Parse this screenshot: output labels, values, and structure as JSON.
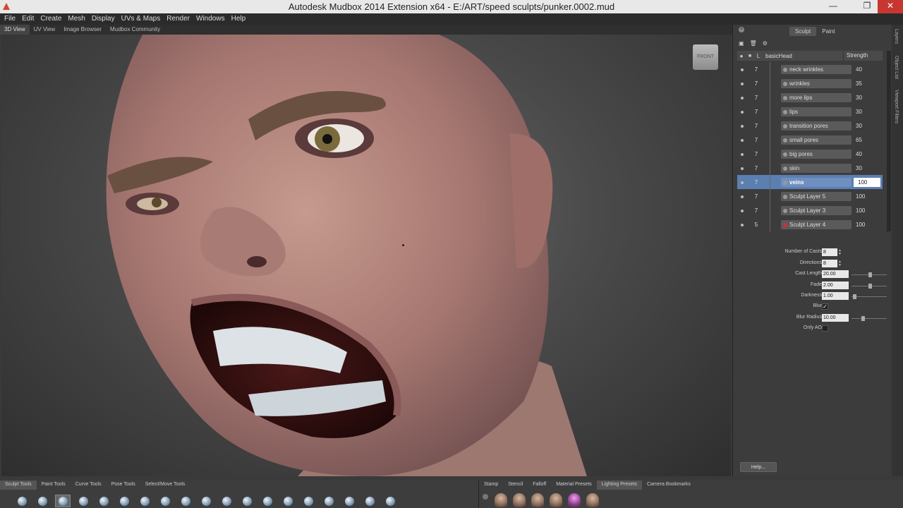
{
  "window": {
    "title": "Autodesk Mudbox 2014 Extension x64 - E:/ART/speed sculpts/punker.0002.mud",
    "close_glyph": "✕",
    "max_glyph": "❐",
    "min_glyph": "—"
  },
  "menu": [
    "File",
    "Edit",
    "Create",
    "Mesh",
    "Display",
    "UVs & Maps",
    "Render",
    "Windows",
    "Help"
  ],
  "view_tabs": [
    "3D View",
    "UV View",
    "Image Browser",
    "Mudbox Community"
  ],
  "viewport": {
    "viewcube_label": "FRONT"
  },
  "right_panel": {
    "mode_tabs": [
      "Sculpt",
      "Paint"
    ],
    "close_glyph": "×",
    "layer_header": {
      "name": "basicHead",
      "strength": "Strength",
      "l": "L"
    },
    "layers": [
      {
        "level": "7",
        "name": "neck wrinkles",
        "strength": "40"
      },
      {
        "level": "7",
        "name": "wrinkles",
        "strength": "35"
      },
      {
        "level": "7",
        "name": "more lips",
        "strength": "30"
      },
      {
        "level": "7",
        "name": "lips",
        "strength": "30"
      },
      {
        "level": "7",
        "name": "transition pores",
        "strength": "30"
      },
      {
        "level": "7",
        "name": "small pores",
        "strength": "65"
      },
      {
        "level": "7",
        "name": "big pores",
        "strength": "40"
      },
      {
        "level": "7",
        "name": "skin",
        "strength": "30"
      },
      {
        "level": "7",
        "name": "veins",
        "strength": "100",
        "selected": true
      },
      {
        "level": "7",
        "name": "Sculpt Layer 5",
        "strength": "100"
      },
      {
        "level": "7",
        "name": "Sculpt Layer 3",
        "strength": "100"
      },
      {
        "level": "5",
        "name": "Sculpt Layer 4",
        "strength": "100",
        "red": true
      }
    ],
    "ao": {
      "num_casts_label": "Number of Casts",
      "num_casts": "8",
      "directions_label": "Directions",
      "directions": "8",
      "cast_length_label": "Cast Length",
      "cast_length": "20.00",
      "fade_label": "Fade",
      "fade": "2.00",
      "darkness_label": "Darkness",
      "darkness": "1.00",
      "blur_label": "Blur",
      "blur_checked": "✓",
      "blur_radius_label": "Blur Radius",
      "blur_radius": "10.00",
      "only_ao_label": "Only AO"
    },
    "help": "Help..."
  },
  "side_tabs": [
    "Layers",
    "Object List",
    "Viewport Filters"
  ],
  "tray_left": {
    "tabs": [
      "Sculpt Tools",
      "Paint Tools",
      "Curve Tools",
      "Pose Tools",
      "Select/Move Tools"
    ]
  },
  "tray_right": {
    "tabs": [
      "Stamp",
      "Stencil",
      "Falloff",
      "Material Presets",
      "Lighting Presets",
      "Camera Bookmarks"
    ]
  }
}
